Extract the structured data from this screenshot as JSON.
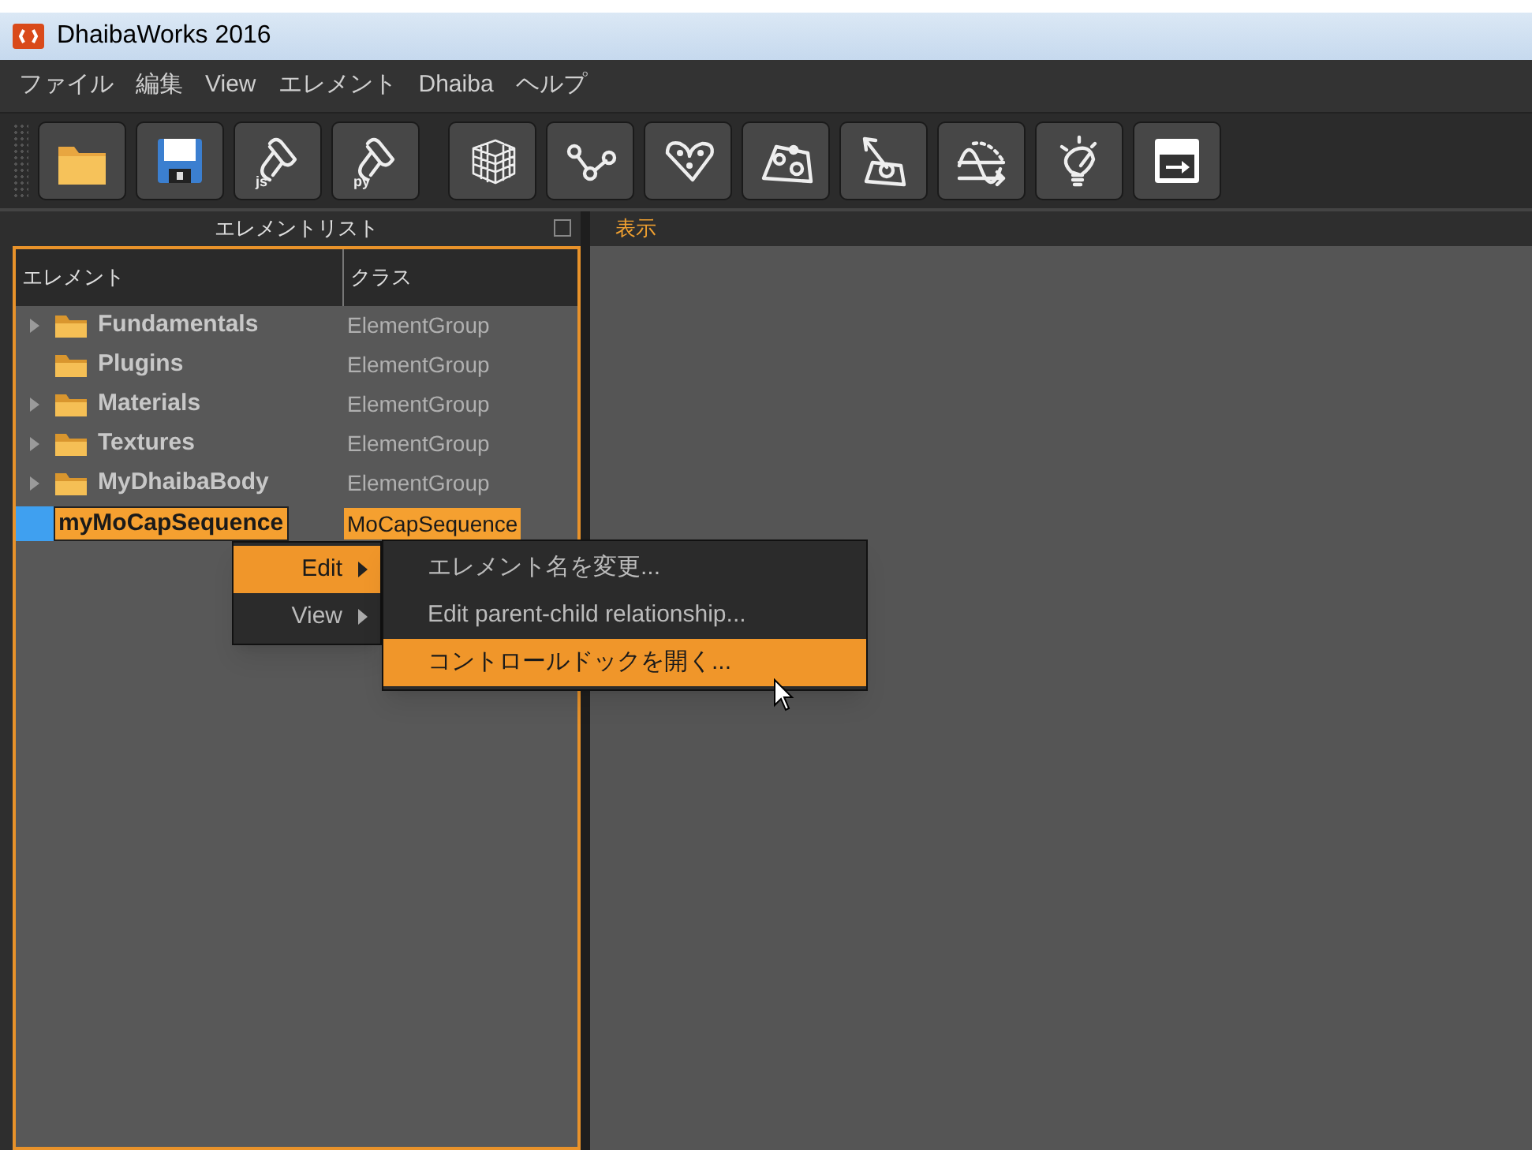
{
  "window": {
    "title": "DhaibaWorks 2016"
  },
  "menu_bar": [
    "ファイル",
    "編集",
    "View",
    "エレメント",
    "Dhaiba",
    "ヘルプ"
  ],
  "toolbar": [
    {
      "kind": "folder"
    },
    {
      "kind": "save"
    },
    {
      "kind": "script",
      "label": "js"
    },
    {
      "kind": "script",
      "label": "py"
    },
    {
      "kind": "mesh"
    },
    {
      "kind": "graph"
    },
    {
      "kind": "path"
    },
    {
      "kind": "map"
    },
    {
      "kind": "transform"
    },
    {
      "kind": "curve"
    },
    {
      "kind": "bulb"
    },
    {
      "kind": "export"
    }
  ],
  "element_list": {
    "title": "エレメントリスト",
    "columns": [
      "エレメント",
      "クラス"
    ],
    "rows": [
      {
        "name": "Fundamentals",
        "class": "ElementGroup",
        "expandable": true,
        "folder": true,
        "selected": false
      },
      {
        "name": "Plugins",
        "class": "ElementGroup",
        "expandable": false,
        "folder": true,
        "selected": false
      },
      {
        "name": "Materials",
        "class": "ElementGroup",
        "expandable": true,
        "folder": true,
        "selected": false
      },
      {
        "name": "Textures",
        "class": "ElementGroup",
        "expandable": true,
        "folder": true,
        "selected": false
      },
      {
        "name": "MyDhaibaBody",
        "class": "ElementGroup",
        "expandable": true,
        "folder": true,
        "selected": false
      },
      {
        "name": "myMoCapSequence",
        "class": "MoCapSequence",
        "expandable": false,
        "folder": false,
        "selected": true
      }
    ]
  },
  "display": {
    "title": "表示"
  },
  "context_menu": [
    {
      "label": "Edit",
      "selected": true
    },
    {
      "label": "View",
      "selected": false
    }
  ],
  "submenu": [
    {
      "label": "エレメント名を変更...",
      "selected": false
    },
    {
      "label": "Edit parent-child relationship...",
      "selected": false
    },
    {
      "label": "コントロールドックを開く...",
      "selected": true
    }
  ]
}
